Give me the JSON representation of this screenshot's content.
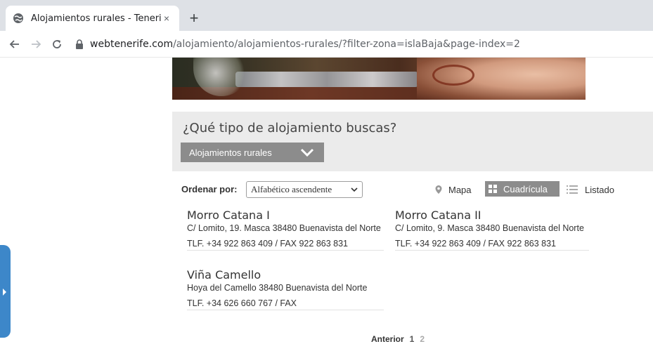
{
  "browser": {
    "tab_title": "Alojamientos rurales - Tenerife",
    "tab_close": "×",
    "new_tab": "+",
    "url_domain": "webtenerife.com",
    "url_path": "/alojamiento/alojamientos-rurales/?filter-zona=islaBaja&page-index=2"
  },
  "search": {
    "title": "¿Qué tipo de alojamiento buscas?",
    "selected_type": "Alojamientos rurales"
  },
  "controls": {
    "sort_label": "Ordenar por:",
    "sort_value": "Alfabético ascendente",
    "view_map": "Mapa",
    "view_grid": "Cuadrícula",
    "view_list": "Listado"
  },
  "listings": [
    {
      "name": "Morro Catana I",
      "address": "C/ Lomito, 19. Masca 38480 Buenavista del Norte",
      "phone": "TLF. +34 922 863 409 / FAX 922 863 831"
    },
    {
      "name": "Morro Catana II",
      "address": "C/ Lomito, 9. Masca 38480 Buenavista del Norte",
      "phone": "TLF. +34 922 863 409 / FAX 922 863 831"
    },
    {
      "name": "Viña Camello",
      "address": "Hoya del Camello 38480 Buenavista del Norte",
      "phone": "TLF. +34 626 660 767 / FAX"
    }
  ],
  "pagination": {
    "prev": "Anterior",
    "current": "1",
    "next": "2"
  },
  "icons": {
    "favicon": "globe-icon",
    "back": "arrow-left-icon",
    "forward": "arrow-right-icon",
    "reload": "reload-icon",
    "lock": "lock-icon",
    "map": "map-pin-icon",
    "grid": "grid-icon",
    "list": "list-icon"
  },
  "colors": {
    "side_tab": "#3d87c9",
    "select_bg": "#8c8c8c",
    "panel_bg": "#ebebeb"
  }
}
